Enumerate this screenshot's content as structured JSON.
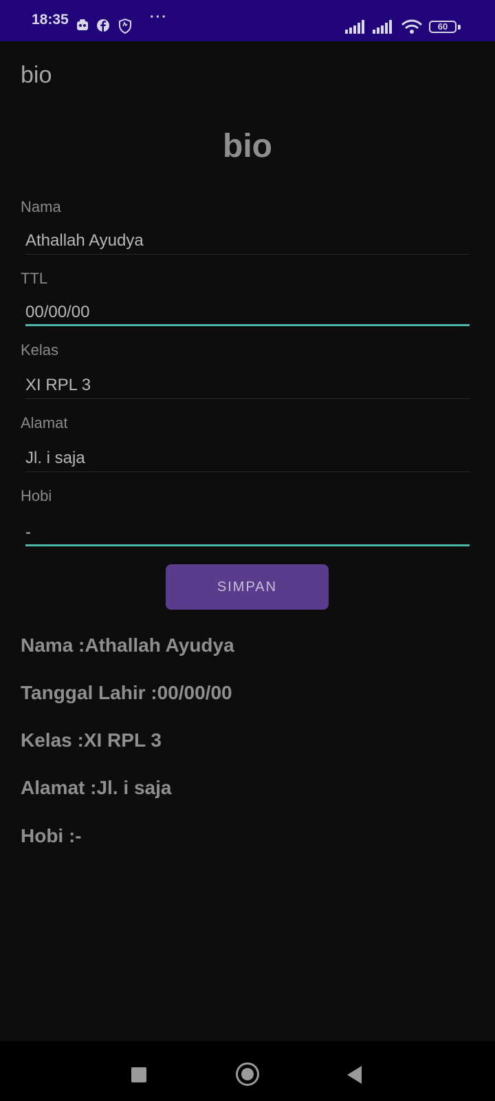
{
  "status_bar": {
    "time": "18:35",
    "overflow": "···",
    "battery": "60",
    "icons": [
      "gallery-icon",
      "facebook-icon",
      "shield-icon",
      "signal-icon",
      "signal-icon",
      "wifi-icon",
      "battery-icon"
    ]
  },
  "app_bar": {
    "title": "bio"
  },
  "form": {
    "heading": "bio",
    "fields": [
      {
        "label": "Nama",
        "value": "Athallah Ayudya"
      },
      {
        "label": "TTL",
        "value": "00/00/00"
      },
      {
        "label": "Kelas",
        "value": "XI RPL 3"
      },
      {
        "label": "Alamat",
        "value": "Jl. i saja"
      },
      {
        "label": "Hobi",
        "value": "-"
      }
    ],
    "save_label": "SIMPAN"
  },
  "output": [
    "Nama :Athallah Ayudya",
    "Tanggal Lahir :00/00/00",
    "Kelas :XI RPL 3",
    "Alamat :Jl. i saja",
    "Hobi :-"
  ],
  "colors": {
    "status_bar": "#22047a",
    "background": "#0d0d0d",
    "accent_underline": "#4db6a5",
    "button": "#5a3c8c"
  }
}
